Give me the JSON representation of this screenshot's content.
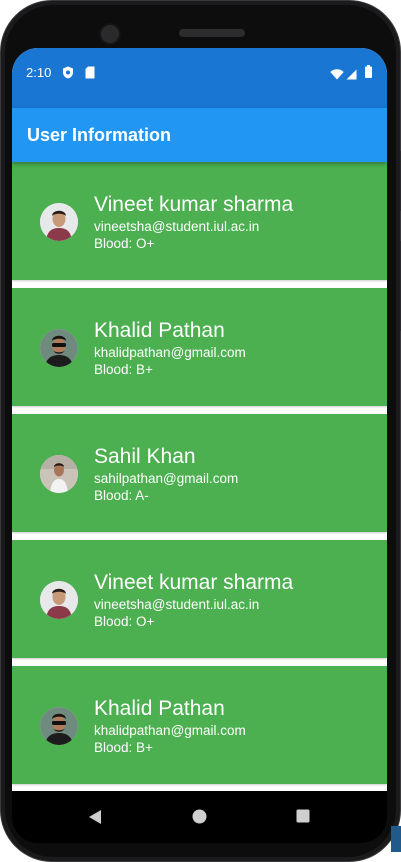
{
  "status_bar": {
    "time": "2:10",
    "icons": [
      "shield-icon",
      "sim-card-icon",
      "wifi-icon",
      "signal-icon",
      "battery-icon"
    ]
  },
  "app_bar": {
    "title": "User Information"
  },
  "colors": {
    "status_bar": "#1976d2",
    "app_bar": "#2196f3",
    "card": "#4caf50",
    "text": "#ffffff"
  },
  "users": [
    {
      "name": "Vineet kumar sharma",
      "email": "vineetsha@student.iul.ac.in",
      "blood": "Blood: O+"
    },
    {
      "name": "Khalid Pathan",
      "email": "khalidpathan@gmail.com",
      "blood": "Blood: B+"
    },
    {
      "name": "Sahil Khan",
      "email": "sahilpathan@gmail.com",
      "blood": "Blood: A-"
    },
    {
      "name": "Vineet kumar sharma",
      "email": "vineetsha@student.iul.ac.in",
      "blood": "Blood: O+"
    },
    {
      "name": "Khalid Pathan",
      "email": "khalidpathan@gmail.com",
      "blood": "Blood: B+"
    }
  ],
  "nav_bar": {
    "icons": [
      "back-icon",
      "home-icon",
      "recents-icon"
    ]
  }
}
